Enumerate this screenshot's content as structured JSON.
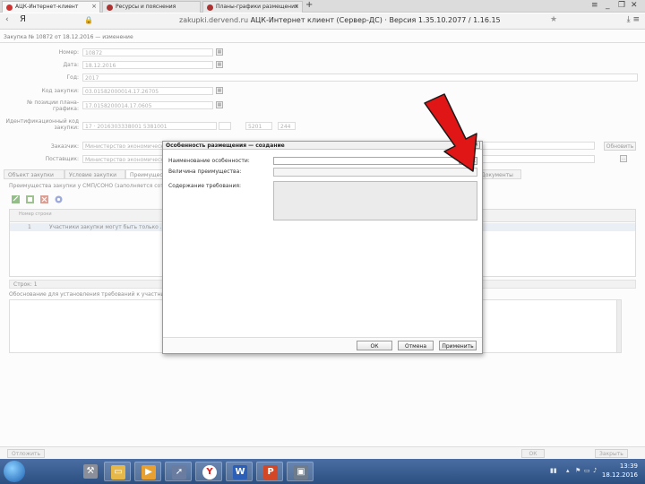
{
  "browser": {
    "tabs": [
      {
        "label": "АЦК-Интернет-клиент",
        "active": true
      },
      {
        "label": "Ресурсы и пояснения"
      },
      {
        "label": "Планы-графики размещения"
      }
    ],
    "new_tab": "+",
    "address_prefix": "Я",
    "url_domain": "zakupki.dervend.ru",
    "url_title": "АЦК-Интернет клиент (Сервер-ДС) · Версия 1.35.10.2077 / 1.16.15",
    "icons": {
      "back": "back-arrow-icon",
      "star": "star-icon",
      "menu": "menu-icon",
      "download": "download-icon"
    }
  },
  "app": {
    "doc_title": "Закупка № 10872 от 18.12.2016 — изменение",
    "fields": [
      {
        "label": "Номер:",
        "value": "10872"
      },
      {
        "label": "Дата:",
        "value": "18.12.2016"
      },
      {
        "label": "Год:",
        "value": "2017"
      },
      {
        "label": "Код закупки:",
        "value": "03.01582000014.17.26705"
      },
      {
        "label": "№ позиции плана-графика:",
        "value": "17.0158200014.17.0605"
      },
      {
        "label": "Идентификационный код закупки:",
        "value": "17  ·  2016303338001 5381001"
      },
      {
        "label": "Заказчик:",
        "value": "Министерство экономического развития"
      },
      {
        "label": "Поставщик:",
        "value": "Министерство экономического развития"
      }
    ],
    "ikz_extra": [
      "5201",
      "244"
    ],
    "side_btn": "Обновить",
    "tabs": [
      "Объект закупки",
      "Условие закупки",
      "Преимущества",
      "Документы"
    ],
    "section_note": "Преимущества закупки у СМП/СОНО (заполняется сотрудником)",
    "grid": {
      "header": "Номер строки",
      "row": {
        "num": "1",
        "text": "Участники закупки могут быть только ..."
      }
    },
    "row_count": "Строк: 1",
    "description_label": "Обоснование для установления требований к участникам",
    "footer": {
      "left": "Отложить",
      "ok": "ОК",
      "close": "Закрыть"
    }
  },
  "modal": {
    "title": "Особенность размещения — создание",
    "fields": [
      {
        "label": "Наименование особенности:",
        "value": ""
      },
      {
        "label": "Величина преимущества:",
        "value": ""
      },
      {
        "label": "Содержание требования:",
        "value": ""
      }
    ],
    "buttons": {
      "ok": "ОК",
      "cancel": "Отмена",
      "apply": "Применить"
    },
    "lookup_btn": "…",
    "clear_btn": "×"
  },
  "taskbar": {
    "time": "13:39",
    "date": "18.12.2016",
    "apps": [
      "Windows",
      "Проводник",
      "Yandex",
      "Word",
      "PowerPoint",
      "Приложение"
    ]
  },
  "colors": {
    "arrow": "#e01515",
    "taskbar": "#2c4f80",
    "tab_active": "#f7f7f7"
  }
}
